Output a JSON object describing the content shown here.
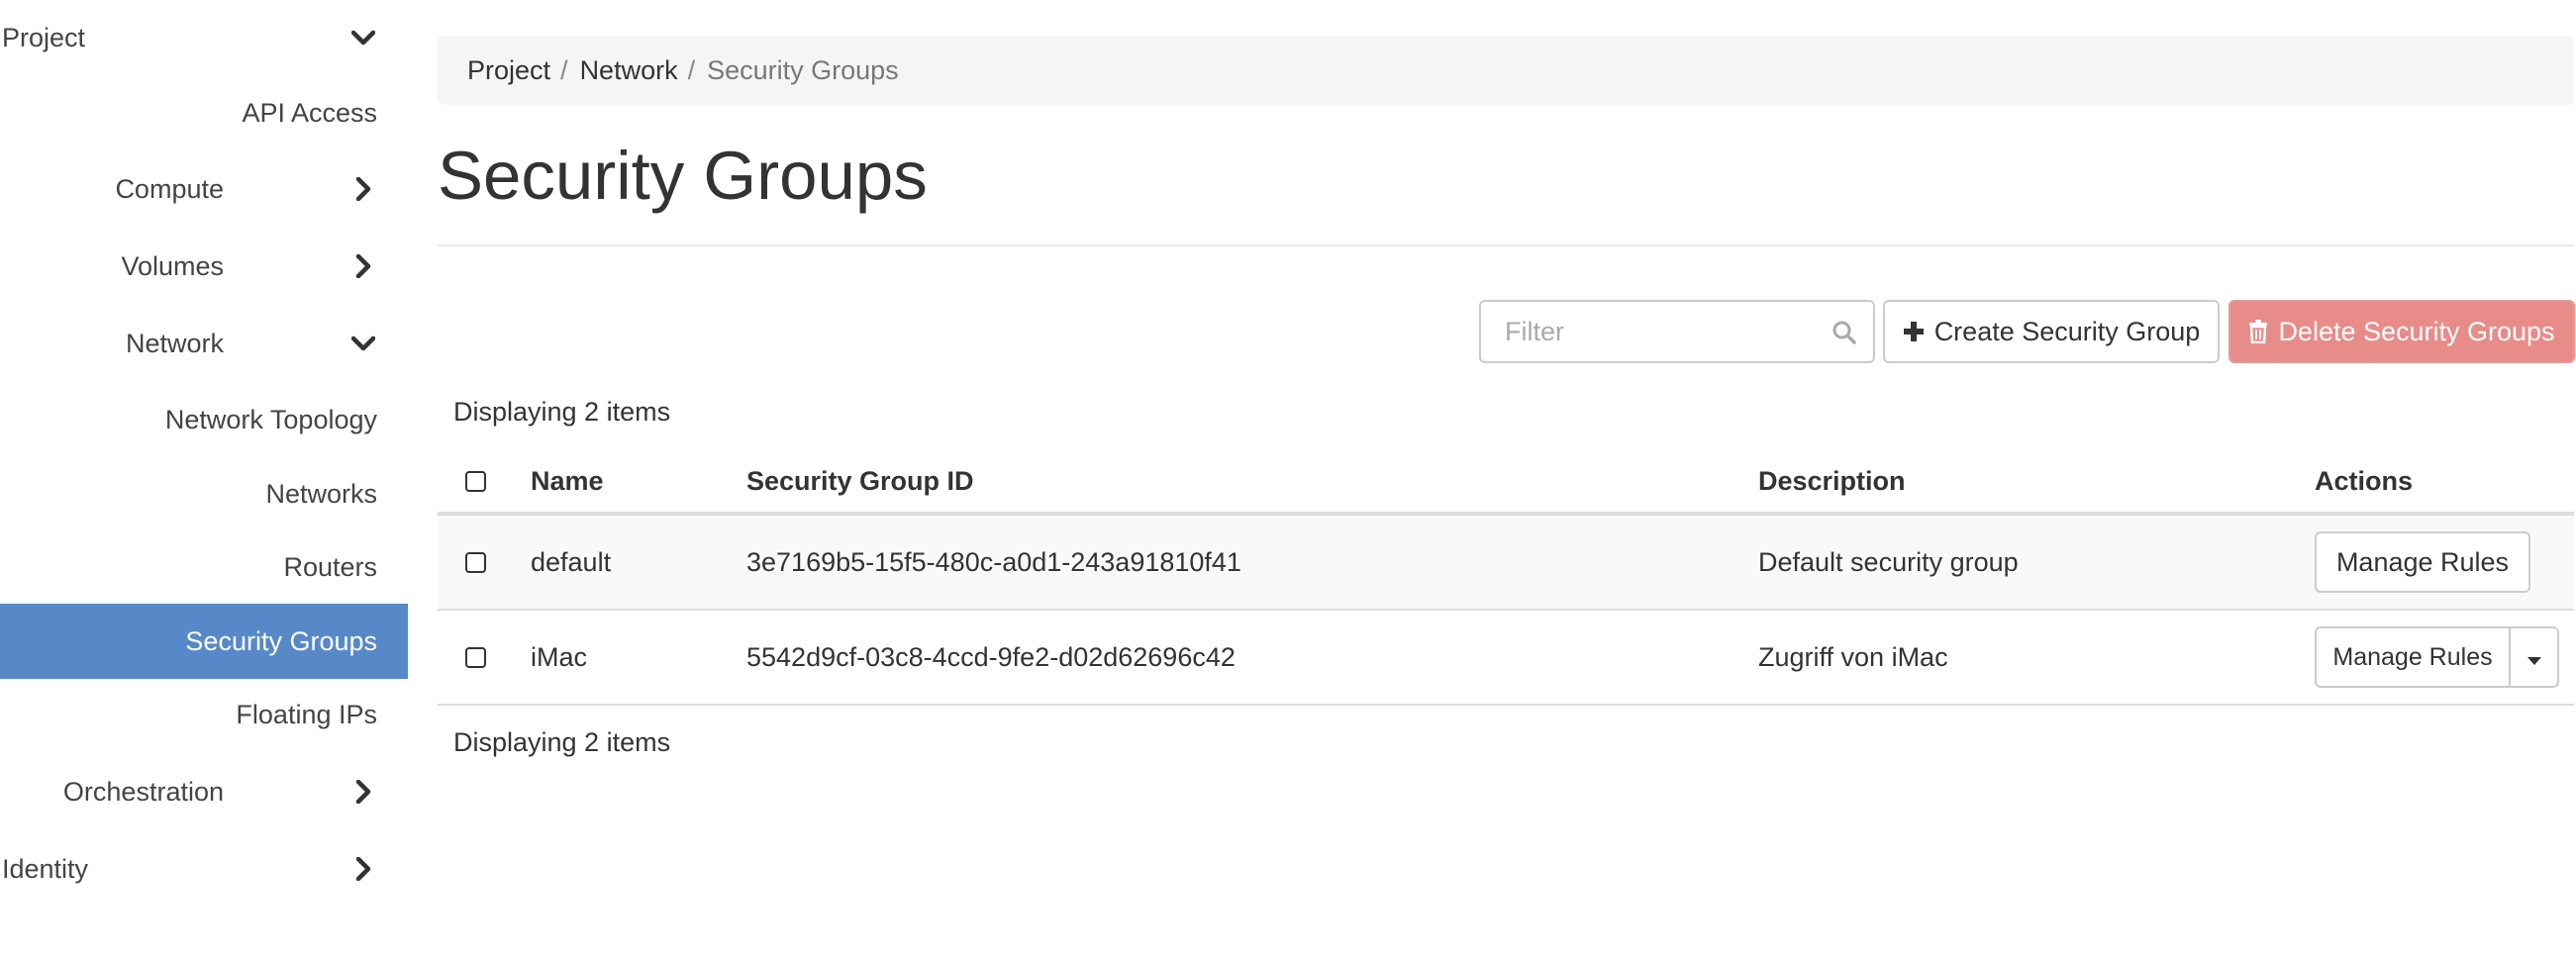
{
  "sidebar": {
    "project": "Project",
    "api_access": "API Access",
    "compute": "Compute",
    "volumes": "Volumes",
    "network": "Network",
    "network_topology": "Network Topology",
    "networks": "Networks",
    "routers": "Routers",
    "security_groups": "Security Groups",
    "floating_ips": "Floating IPs",
    "orchestration": "Orchestration",
    "identity": "Identity",
    "active_item": "Security Groups",
    "active_color": "#5789c8"
  },
  "breadcrumb": {
    "items": [
      "Project",
      "Network",
      "Security Groups"
    ],
    "separator": "/"
  },
  "page": {
    "title": "Security Groups"
  },
  "toolbar": {
    "filter_placeholder": "Filter",
    "filter_value": "",
    "create_label": "Create Security Group",
    "delete_label": "Delete Security Groups",
    "delete_color": "#e78c89"
  },
  "table": {
    "count_label": "Displaying 2 items",
    "columns": [
      "Name",
      "Security Group ID",
      "Description",
      "Actions"
    ],
    "rows": [
      {
        "name": "default",
        "id": "3e7169b5-15f5-480c-a0d1-243a91810f41",
        "description": "Default security group",
        "action": "Manage Rules"
      },
      {
        "name": "iMac",
        "id": "5542d9cf-03c8-4ccd-9fe2-d02d62696c42",
        "description": "Zugriff von iMac",
        "action": "Manage Rules"
      }
    ]
  },
  "icons": {
    "chevron_down": "chevron-down-icon",
    "chevron_right": "chevron-right-icon",
    "search": "search-icon",
    "plus": "plus-icon",
    "trash": "trash-icon",
    "caret_down": "caret-down-icon"
  }
}
